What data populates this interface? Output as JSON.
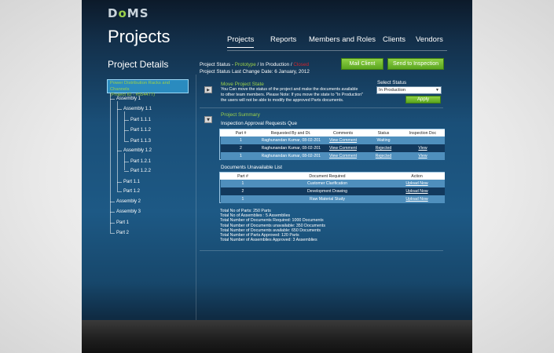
{
  "brand": {
    "logo_prefix": "D",
    "logo_accent": "o",
    "logo_suffix": "MS"
  },
  "page": {
    "title": "Projects"
  },
  "nav": {
    "items": [
      {
        "label": "Projects",
        "active": true
      },
      {
        "label": "Reports"
      },
      {
        "label": "Members and Roles"
      },
      {
        "label": "Clients"
      },
      {
        "label": "Vendors"
      }
    ]
  },
  "details": {
    "heading": "Project Details",
    "status_prefix": "Project Status - ",
    "status_prototype": "Prototype",
    "status_sep1": " / ",
    "status_in_production": "In Production",
    "status_sep2": " / ",
    "status_closed": "Closed",
    "last_change": "Project Status Last Change Date: 6 January, 2012",
    "mail_client_label": "Mail Client",
    "send_inspection_label": "Send to Inspection"
  },
  "tree": {
    "root_name": "Power Distribution Racks and Channels",
    "root_id": "(Project ID - #554477)",
    "items": [
      {
        "label": "Assembly 1"
      },
      {
        "label": "Assembly 1.1"
      },
      {
        "label": "Part 1.1.1"
      },
      {
        "label": "Part 1.1.2"
      },
      {
        "label": "Part 1.1.3"
      },
      {
        "label": "Assembly 1.2"
      },
      {
        "label": "Part 1.2.1"
      },
      {
        "label": "Part 1.2.2"
      },
      {
        "label": "Part 1.1"
      },
      {
        "label": "Part 1.2"
      },
      {
        "label": "Assembly 2"
      },
      {
        "label": "Assembly 3"
      },
      {
        "label": "Part 1"
      },
      {
        "label": "Part 2"
      }
    ]
  },
  "move_state": {
    "title": "Move Project State",
    "description_line1": "You Can move the status of the project and make the documents available",
    "description_line2": "to other team members. Please Note: If you move the state to \"In Production\"",
    "description_line3": "the users will not be able to modify the approved Parts documents.",
    "select_label": "Select Status",
    "selected_value": "In Production",
    "apply_label": "Apply"
  },
  "summary": {
    "title": "Project Summary",
    "inspection_title": "Inspection Approval Requests Que",
    "inspection_columns": [
      "Part #",
      "Requested By and Dt.",
      "Comments",
      "Status",
      "Inspection Doc"
    ],
    "inspection_rows": [
      {
        "part": "1",
        "requested": "Raghunandan Kumar, 08-02-2012",
        "comments": "View Comment",
        "status": "Waiting",
        "doc": ""
      },
      {
        "part": "2",
        "requested": "Raghunandan Kumar, 08-02-2012",
        "comments": "View Comment",
        "status": "Rejected",
        "doc": "View"
      },
      {
        "part": "1",
        "requested": "Raghunandan Kumar, 08-02-2012",
        "comments": "View Comment",
        "status": "Rejected",
        "doc": "View"
      }
    ],
    "unavailable_title": "Documents Unavailable List",
    "unavailable_columns": [
      "Part #",
      "Document Required",
      "Action"
    ],
    "unavailable_rows": [
      {
        "part": "1",
        "document": "Customer Clarification",
        "action": "Upload Now"
      },
      {
        "part": "2",
        "document": "Development Drawing",
        "action": "Upload Now"
      },
      {
        "part": "1",
        "document": "Raw Material Study",
        "action": "Upload Now"
      }
    ],
    "totals": [
      "Total No of Parts: 250 Parts",
      "Total No of Assemblies : 5 Assemblies",
      "Total Number of Documents Required: 1000 Documents",
      "Total Number of Documents unavailable: 350 Documents",
      "Total Number of Documents available: 650 Documents",
      "Total Number of Parts Approved: 120 Parts",
      "Total Number of Assemblies Approved: 3 Assemblies"
    ]
  },
  "colors": {
    "accent_green": "#9bd04a",
    "closed_red": "#d2232a",
    "panel_blue": "#1d5985"
  },
  "icons": {
    "move_state_toggle": "arrow-right-icon",
    "summary_toggle": "arrow-down-icon",
    "select_caret": "chevron-down-icon"
  }
}
